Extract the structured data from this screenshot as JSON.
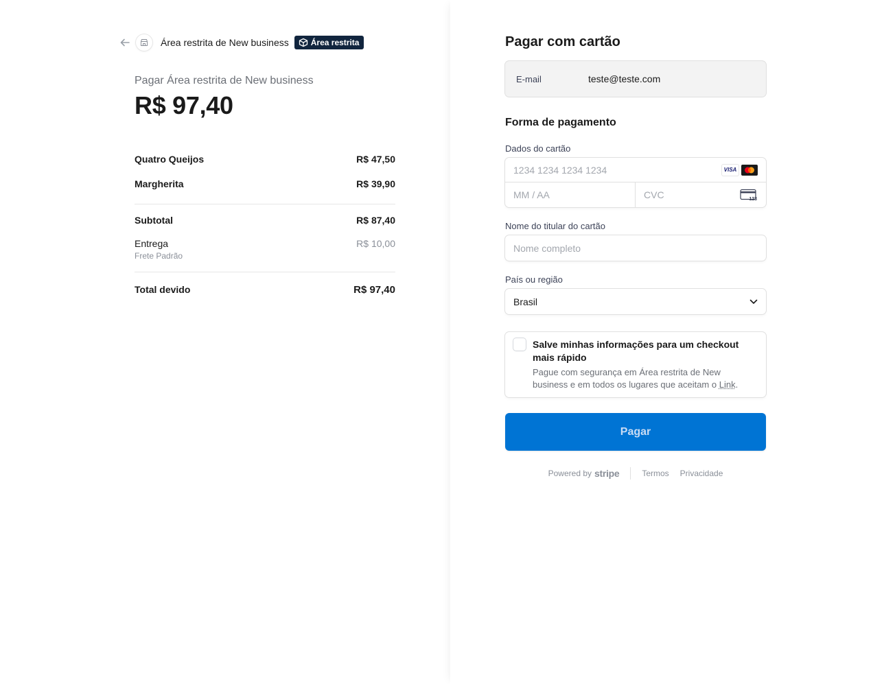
{
  "header": {
    "merchant_name": "Área restrita de New business",
    "badge_label": "Área restrita"
  },
  "summary": {
    "pay_label": "Pagar Área restrita de New business",
    "amount": "R$ 97,40",
    "items": [
      {
        "name": "Quatro Queijos",
        "price": "R$ 47,50"
      },
      {
        "name": "Margherita",
        "price": "R$ 39,90"
      }
    ],
    "subtotal": {
      "label": "Subtotal",
      "value": "R$ 87,40"
    },
    "shipping": {
      "label": "Entrega",
      "sublabel": "Frete Padrão",
      "value": "R$ 10,00"
    },
    "total": {
      "label": "Total devido",
      "value": "R$ 97,40"
    }
  },
  "form": {
    "title": "Pagar com cartão",
    "email_label": "E-mail",
    "email_value": "teste@teste.com",
    "payment_method_title": "Forma de pagamento",
    "card_label": "Dados do cartão",
    "card_number_placeholder": "1234 1234 1234 1234",
    "card_brand_visa": "VISA",
    "expiry_placeholder": "MM / AA",
    "cvc_placeholder": "CVC",
    "cvc_icon_text": "123",
    "name_label": "Nome do titular do cartão",
    "name_placeholder": "Nome completo",
    "country_label": "País ou região",
    "country_value": "Brasil",
    "save_title": "Salve minhas informações para um checkout mais rápido",
    "save_desc_prefix": "Pague com segurança em Área restrita de New business e em todos os lugares que aceitam o ",
    "save_desc_link": "Link",
    "save_desc_suffix": ".",
    "pay_button": "Pagar"
  },
  "footer": {
    "powered_by": "Powered by",
    "stripe": "stripe",
    "terms": "Termos",
    "privacy": "Privacidade"
  },
  "colors": {
    "primary_button": "#0074d4",
    "badge_bg": "#11253e"
  },
  "icons": [
    "arrow-left-icon",
    "store-icon",
    "box-icon",
    "visa-icon",
    "mastercard-icon",
    "cvc-card-icon",
    "chevron-down-icon"
  ]
}
